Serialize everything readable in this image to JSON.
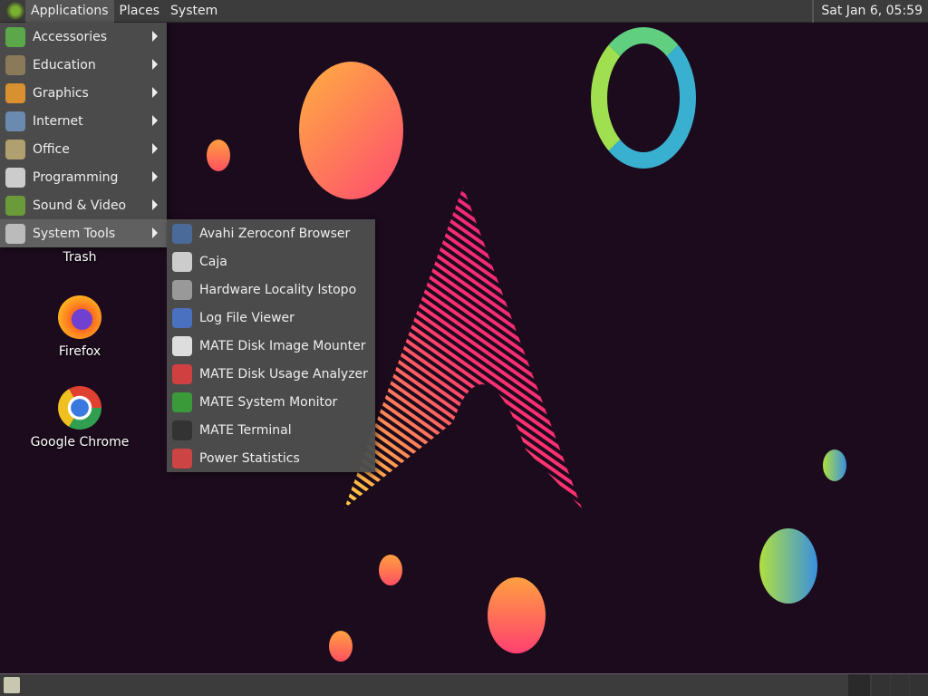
{
  "panel": {
    "menus": [
      "Applications",
      "Places",
      "System"
    ],
    "clock": "Sat Jan  6, 05:59"
  },
  "apps_menu": [
    {
      "label": "Accessories",
      "icon": "accessories-icon",
      "color": "#5aa84a"
    },
    {
      "label": "Education",
      "icon": "education-icon",
      "color": "#8a7a5a"
    },
    {
      "label": "Graphics",
      "icon": "graphics-icon",
      "color": "#d89030"
    },
    {
      "label": "Internet",
      "icon": "internet-icon",
      "color": "#6a8ab0"
    },
    {
      "label": "Office",
      "icon": "office-icon",
      "color": "#b0a070"
    },
    {
      "label": "Programming",
      "icon": "programming-icon",
      "color": "#cccccc"
    },
    {
      "label": "Sound & Video",
      "icon": "sound-video-icon",
      "color": "#6a9a3a"
    },
    {
      "label": "System Tools",
      "icon": "gear-icon",
      "color": "#bbbbbb"
    }
  ],
  "system_tools_menu": [
    {
      "label": "Avahi Zeroconf Browser",
      "icon": "avahi-icon",
      "color": "#4a6a9a"
    },
    {
      "label": "Caja",
      "icon": "file-cabinet-icon",
      "color": "#cccccc"
    },
    {
      "label": "Hardware Locality lstopo",
      "icon": "hardware-icon",
      "color": "#999999"
    },
    {
      "label": "Log File Viewer",
      "icon": "log-viewer-icon",
      "color": "#4a70c0"
    },
    {
      "label": "MATE Disk Image Mounter",
      "icon": "disk-image-icon",
      "color": "#dddddd"
    },
    {
      "label": "MATE Disk Usage Analyzer",
      "icon": "disk-usage-icon",
      "color": "#d04040"
    },
    {
      "label": "MATE System Monitor",
      "icon": "system-monitor-icon",
      "color": "#3a9a3a"
    },
    {
      "label": "MATE Terminal",
      "icon": "terminal-icon",
      "color": "#333333"
    },
    {
      "label": "Power Statistics",
      "icon": "power-statistics-icon",
      "color": "#cc4444"
    }
  ],
  "desktop": [
    "Trash",
    "Firefox",
    "Google Chrome"
  ]
}
